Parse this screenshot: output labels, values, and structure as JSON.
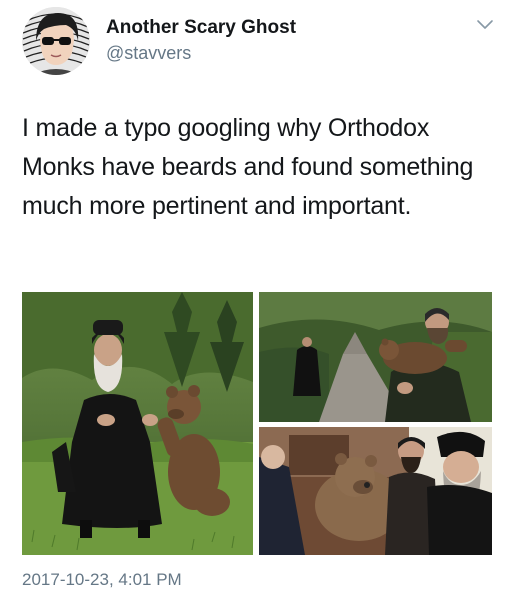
{
  "author": {
    "display_name": "Another Scary Ghost",
    "handle": "@stavvers"
  },
  "tweet": {
    "text": "I made a typo googling why Orthodox Monks have beards and found something much more pertinent and important."
  },
  "media": {
    "photos": [
      {
        "subject": "Bearded monk sitting on grass with a bear cub"
      },
      {
        "subject": "Monk on a forest path and a man carrying a bear cub"
      },
      {
        "subject": "Bearded monks posing with a bear"
      }
    ]
  },
  "meta": {
    "timestamp": "2017-10-23, 4:01 PM"
  },
  "icons": {
    "menu": "chevron-down-icon",
    "avatar": "avatar-icon"
  },
  "colors": {
    "text": "#14171a",
    "secondary": "#657786"
  }
}
